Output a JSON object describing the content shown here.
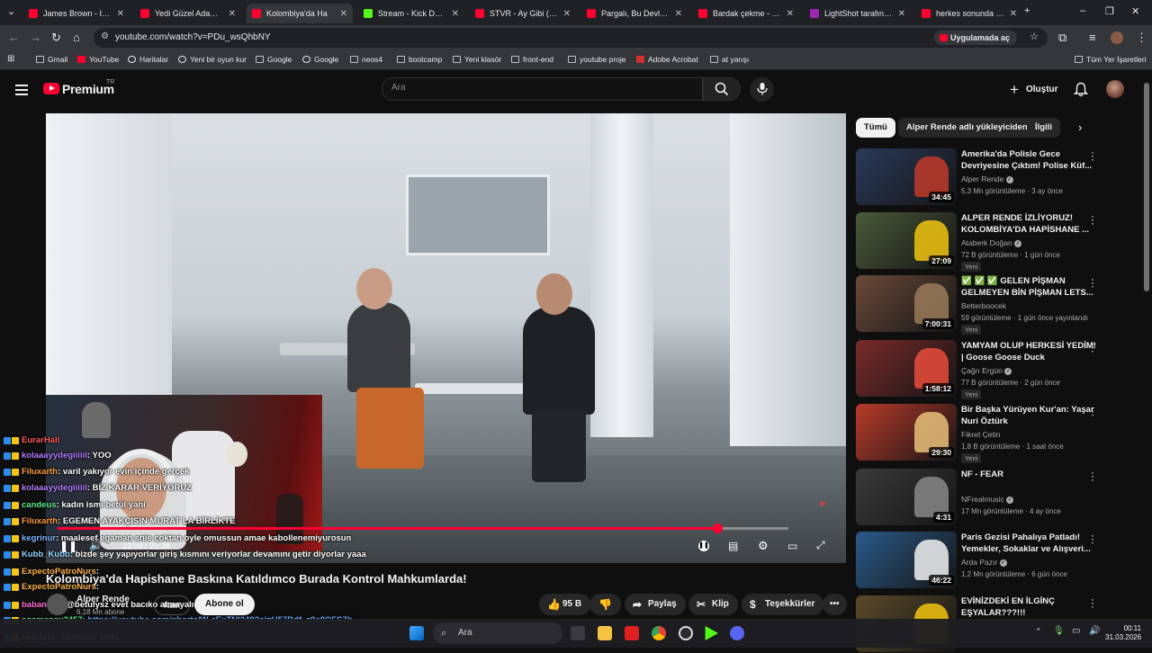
{
  "browser": {
    "tabs": [
      {
        "title": "James Brown - It's A M",
        "color": "#ff0033"
      },
      {
        "title": "Yedi Güzel Adam - Öz",
        "color": "#ff0033"
      },
      {
        "title": "Kolombiya'da Ha",
        "color": "#ff0033",
        "active": true
      },
      {
        "title": "Stream - Kick Dashbo",
        "color": "#53fc18"
      },
      {
        "title": "STVR - Ay Gibi (prod.",
        "color": "#ff0033"
      },
      {
        "title": "Pargalı, Bu Devleti Be",
        "color": "#ff0033"
      },
      {
        "title": "Bardak çekme - YouTu",
        "color": "#ff0033"
      },
      {
        "title": "LightShot tarafından",
        "color": "#9c27b0"
      },
      {
        "title": "herkes sonunda olma",
        "color": "#ff0033"
      }
    ],
    "new_tab": "+",
    "url": "youtube.com/watch?v=PDu_wsQhbNY",
    "open_in_app": "Uygulamada aç",
    "bookmarks": [
      {
        "label": "Gmail",
        "icon": "mail-icon"
      },
      {
        "label": "YouTube",
        "icon": "youtube-icon"
      },
      {
        "label": "Haritalar",
        "icon": "maps-icon"
      },
      {
        "label": "Yeni bir oyun kur",
        "icon": "game-icon"
      },
      {
        "label": "Google",
        "icon": "folder-icon"
      },
      {
        "label": "Google",
        "icon": "google-icon"
      },
      {
        "label": "neos4",
        "icon": "folder-icon"
      },
      {
        "label": "bootcamp",
        "icon": "folder-icon"
      },
      {
        "label": "Yeni klasör",
        "icon": "folder-icon"
      },
      {
        "label": "front-end",
        "icon": "folder-icon"
      },
      {
        "label": "youtube proje",
        "icon": "folder-icon"
      },
      {
        "label": "Adobe Acrobat",
        "icon": "pdf-icon"
      },
      {
        "label": "at yarışı",
        "icon": "folder-icon"
      }
    ],
    "all_bookmarks": "Tüm Yer İşaretleri"
  },
  "masthead": {
    "brand": "Premium",
    "region": "TR",
    "search_placeholder": "Ara",
    "create": "Oluştur"
  },
  "player": {
    "time_current": "23:09",
    "time_total": "25:38",
    "progress": 0.903,
    "chat": [
      {
        "user": "EurarHall",
        "msg": "",
        "color": "#ff5a5a"
      },
      {
        "user": "kolaaayydegiiiiil",
        "msg": " : YOO",
        "color": "#b57cff"
      },
      {
        "user": "Filuxarth",
        "msg": " : varil yakıyor evin içinde gerçek",
        "color": "#ff9d3d"
      },
      {
        "user": "kolaaayydegiiiiil",
        "msg": " : BİZ KARAR VERİYORUZ",
        "color": "#b57cff"
      },
      {
        "user": "candeus",
        "msg": " : kadın ismi betül yani",
        "color": "#5cf08a"
      },
      {
        "user": "Filuxarth",
        "msg": " : EGEMEN AYAKÇISIN MURAT LA BİRLİKTE",
        "color": "#ff9d3d"
      },
      {
        "user": "kegrinur",
        "msg": " : maalesef egaman snie çoktan oyle omussun amae kabollenemiyurosun",
        "color": "#7fb3ff"
      },
      {
        "user": "Kubb_Kubb",
        "msg": " : bizde şey yapıyorlar giriş kısmını veriyorlar devamını getir diyorlar yaaa",
        "color": "#8fd3ff"
      },
      {
        "user": "ExpectoPatroNurs",
        "msg": " :",
        "color": "#ffb347"
      },
      {
        "user": "ExpectoPatroNurs",
        "msg": " :",
        "color": "#ffb347"
      },
      {
        "user": "babaneva",
        "msg": " : @betulysz evet bacıko almayalım onu",
        "color": "#ff6bd5"
      },
      {
        "user": "egemensv3457",
        "msg": " : https://youtube.com/shorts/W-cExTNI248?si=U57Bdf_z8a8OFS7h",
        "color": "#5cf08a",
        "link": true
      },
      {
        "user": "betulysz",
        "msg": " : otistikler klanı",
        "color": "#ffffff"
      }
    ]
  },
  "video": {
    "title": "Kolombiya'da Hapishane Baskına Katıldımco Burada Kontrol Mahkumlarda!",
    "channel": "Alper Rende",
    "subscribers": "6,18 Mn abone",
    "join": "Katıl",
    "subscribe": "Abone ol",
    "likes": "95 B",
    "share": "Paylaş",
    "clip": "Klip",
    "thanks": "Teşekkürler"
  },
  "chips": [
    "Tümü",
    "Alper Rende adlı yükleyiciden",
    "İlgili"
  ],
  "recommendations": [
    {
      "title": "Amerika'da Polisle Gece Devriyesine Çıktım! Polise Küf...",
      "channel": "Alper Rende",
      "verified": true,
      "meta": "5,3 Mn görüntüleme · 3 ay önce",
      "duration": "34:45",
      "badge": "",
      "thumb": "#2a3a5a",
      "accent": "#c0392b"
    },
    {
      "title": "ALPER RENDE İZLİYORUZ! KOLOMBİYA'DA HAPİSHANE ...",
      "channel": "Ataberk Doğan",
      "verified": true,
      "meta": "72 B görüntüleme · 1 gün önce",
      "duration": "27:09",
      "badge": "Yeni",
      "thumb": "#4a5a3a",
      "accent": "#f1c40f"
    },
    {
      "title": "✅ ✅ ✅ GELEN PİŞMAN GELMEYEN BİN PİŞMAN LETS...",
      "channel": "Betterboocek",
      "verified": false,
      "meta": "59 görüntüleme · 1 gün önce yayınlandı",
      "duration": "7:00:31",
      "badge": "Yeni",
      "thumb": "#6a4a3a",
      "accent": "#9a7a5a"
    },
    {
      "title": "YAMYAM OLUP HERKESİ YEDİM! | Goose Goose Duck",
      "channel": "Çağrı Ergün",
      "verified": true,
      "meta": "77 B görüntüleme · 2 gün önce",
      "duration": "1:58:12",
      "badge": "Yeni",
      "thumb": "#7a2a2a",
      "accent": "#e74c3c"
    },
    {
      "title": "Bir Başka Yürüyen Kur'an: Yaşar Nuri Öztürk",
      "channel": "Fikret Çetin",
      "verified": false,
      "meta": "1,8 B görüntüleme · 1 saat önce",
      "duration": "29:30",
      "badge": "Yeni",
      "thumb": "#b83a2a",
      "accent": "#e8c07a"
    },
    {
      "title": "NF - FEAR",
      "channel": "NFrealmusic",
      "verified": true,
      "meta": "17 Mn görüntüleme · 4 ay önce",
      "duration": "4:31",
      "badge": "",
      "thumb": "#3a3a3a",
      "accent": "#888888"
    },
    {
      "title": "Paris Gezisi Pahalıya Patladı! Yemekler, Sokaklar ve Alışveri...",
      "channel": "Arda Pazır",
      "verified": true,
      "meta": "1,2 Mn görüntüleme · 6 gün önce",
      "duration": "46:22",
      "badge": "",
      "thumb": "#2a5a8a",
      "accent": "#f1f1f1"
    },
    {
      "title": "EVİNİZDEKİ EN İLGİNÇ EŞYALAR???!!!",
      "channel": "",
      "verified": false,
      "meta": "",
      "duration": "",
      "badge": "",
      "thumb": "#5a4a2a",
      "accent": "#f1c40f"
    }
  ],
  "taskbar": {
    "search": "Ara",
    "time": "00:11",
    "date": "31.03.2026"
  }
}
